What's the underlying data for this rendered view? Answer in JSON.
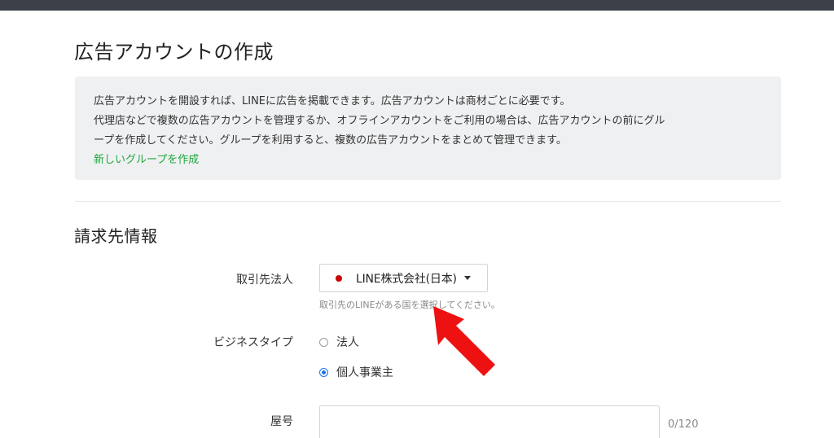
{
  "page": {
    "title": "広告アカウントの作成"
  },
  "info": {
    "line1": "広告アカウントを開設すれば、LINEに広告を掲載できます。広告アカウントは商材ごとに必要です。",
    "line2": "代理店などで複数の広告アカウントを管理するか、オフラインアカウントをご利用の場合は、広告アカウントの前にグル",
    "line3": "ープを作成してください。グループを利用すると、複数の広告アカウントをまとめて管理できます。",
    "link": "新しいグループを作成",
    "link_color": "#1fa73d"
  },
  "billing": {
    "section_title": "請求先情報",
    "partner": {
      "label": "取引先法人",
      "value": "LINE株式会社(日本)",
      "dot_color": "#cc0000",
      "help": "取引先のLINEがある国を選択してください。"
    },
    "business_type": {
      "label": "ビジネスタイプ",
      "options": [
        {
          "label": "法人",
          "checked": false
        },
        {
          "label": "個人事業主",
          "checked": true
        }
      ]
    },
    "yago": {
      "label": "屋号",
      "value": "",
      "counter": "0/120"
    }
  },
  "colors": {
    "topbar": "#3b4049",
    "accent": "#1f74e8",
    "annotation_arrow": "#ee1111"
  }
}
